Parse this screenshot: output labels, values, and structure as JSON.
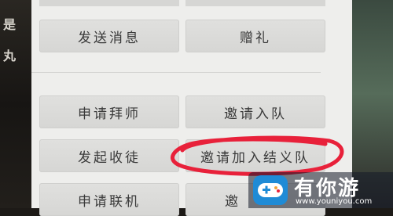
{
  "background": {
    "left_chars": [
      "是",
      "丸"
    ]
  },
  "menu": {
    "row1": {
      "left": "发送消息",
      "right": "赠礼"
    },
    "row2": {
      "left": "申请拜师",
      "right": "邀请入队"
    },
    "row3": {
      "left": "发起收徒",
      "right": "邀请加入结义队"
    },
    "row4": {
      "left": "申请联机",
      "right": "邀"
    }
  },
  "highlight": {
    "color": "#e8213a"
  },
  "watermark": {
    "title": "有你游",
    "url": "www.youniyou.com"
  },
  "colors": {
    "panel": "#eeeeec",
    "button": "#dcdcda",
    "text": "#3a3a3a",
    "accent": "#e8213a",
    "watermark_icon": "#1f8bd6"
  }
}
